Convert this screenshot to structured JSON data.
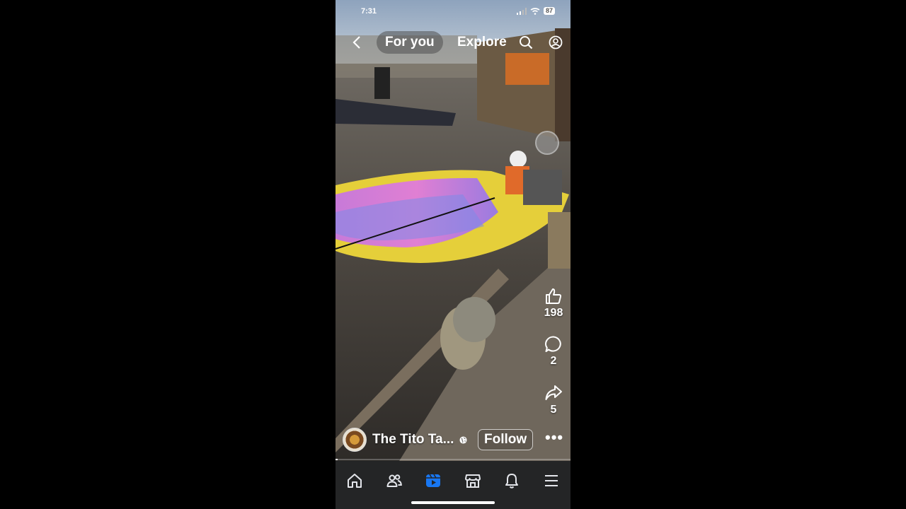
{
  "status_bar": {
    "time": "7:31",
    "battery": "87"
  },
  "top_nav": {
    "tabs": [
      "For you",
      "Explore"
    ]
  },
  "actions": {
    "likes": "198",
    "comments": "2",
    "shares": "5"
  },
  "creator": {
    "name": "The Tito Ta...",
    "follow_label": "Follow",
    "more_label": "•••"
  },
  "video": {
    "progress": 0.01
  },
  "icons": [
    "back-icon",
    "search-icon",
    "profile-icon",
    "like-icon",
    "comment-icon",
    "share-icon",
    "globe-icon",
    "home-icon",
    "friends-icon",
    "video-icon",
    "marketplace-icon",
    "bell-icon",
    "menu-icon"
  ],
  "colors": {
    "tabbar_bg": "#242526",
    "active_tab": "#1877f2",
    "inactive_tab": "#e4e6eb"
  }
}
